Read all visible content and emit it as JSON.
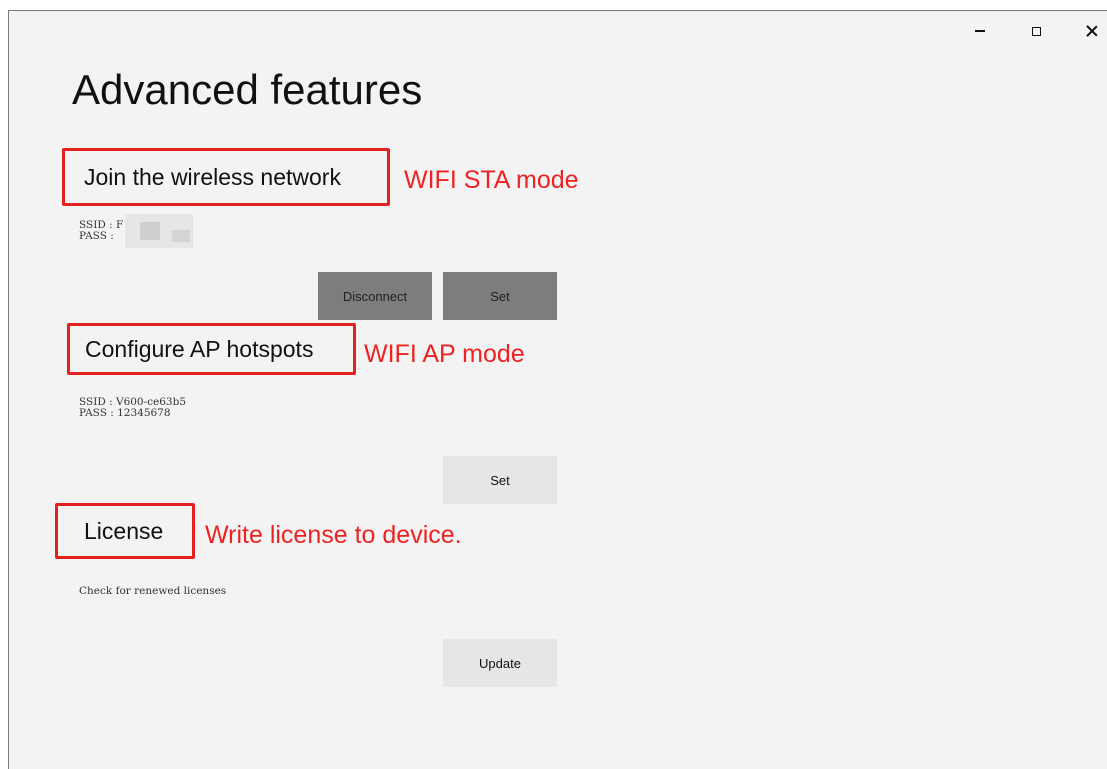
{
  "window_controls": {
    "minimize": "minimize",
    "maximize": "maximize",
    "close": "close"
  },
  "page": {
    "title": "Advanced features"
  },
  "sta": {
    "heading": "Join the wireless network",
    "annotation": "WIFI STA mode",
    "ssid_line": "SSID : F",
    "pass_line": "PASS : ",
    "disconnect_label": "Disconnect",
    "set_label": "Set"
  },
  "ap": {
    "heading": "Configure AP hotspots",
    "annotation": "WIFI AP mode",
    "ssid_line": "SSID : V600-ce63b5",
    "pass_line": "PASS : 12345678",
    "set_label": "Set"
  },
  "license": {
    "heading": "License",
    "annotation": "Write license to device.",
    "status_text": "Check for renewed licenses",
    "update_label": "Update"
  },
  "colors": {
    "annotation": "#ee2222",
    "background": "#f3f3f3",
    "button": "#e6e6e6",
    "button_disabled": "#7d7d7d"
  }
}
